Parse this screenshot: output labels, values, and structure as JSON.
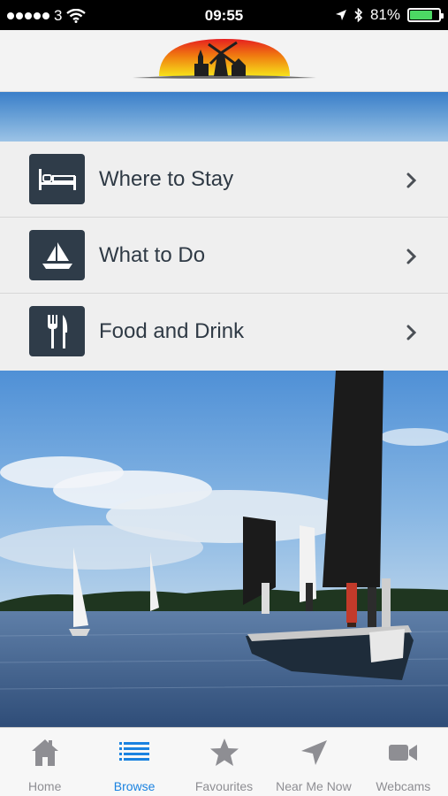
{
  "status_bar": {
    "carrier": "3",
    "time": "09:55",
    "battery": "81%",
    "battery_level": 0.81
  },
  "menu": {
    "items": [
      {
        "label": "Where to Stay",
        "icon": "bed-icon"
      },
      {
        "label": "What to Do",
        "icon": "sailboat-icon"
      },
      {
        "label": "Food and Drink",
        "icon": "fork-knife-icon"
      }
    ]
  },
  "tab_bar": {
    "tabs": [
      {
        "label": "Home",
        "icon": "home-icon",
        "active": false
      },
      {
        "label": "Browse",
        "icon": "list-icon",
        "active": true
      },
      {
        "label": "Favourites",
        "icon": "star-icon",
        "active": false
      },
      {
        "label": "Near Me Now",
        "icon": "location-arrow-icon",
        "active": false
      },
      {
        "label": "Webcams",
        "icon": "video-camera-icon",
        "active": false
      }
    ]
  },
  "colors": {
    "accent": "#1a82e0",
    "inactive": "#8e8e93",
    "icon_tile": "#2f3c49"
  }
}
